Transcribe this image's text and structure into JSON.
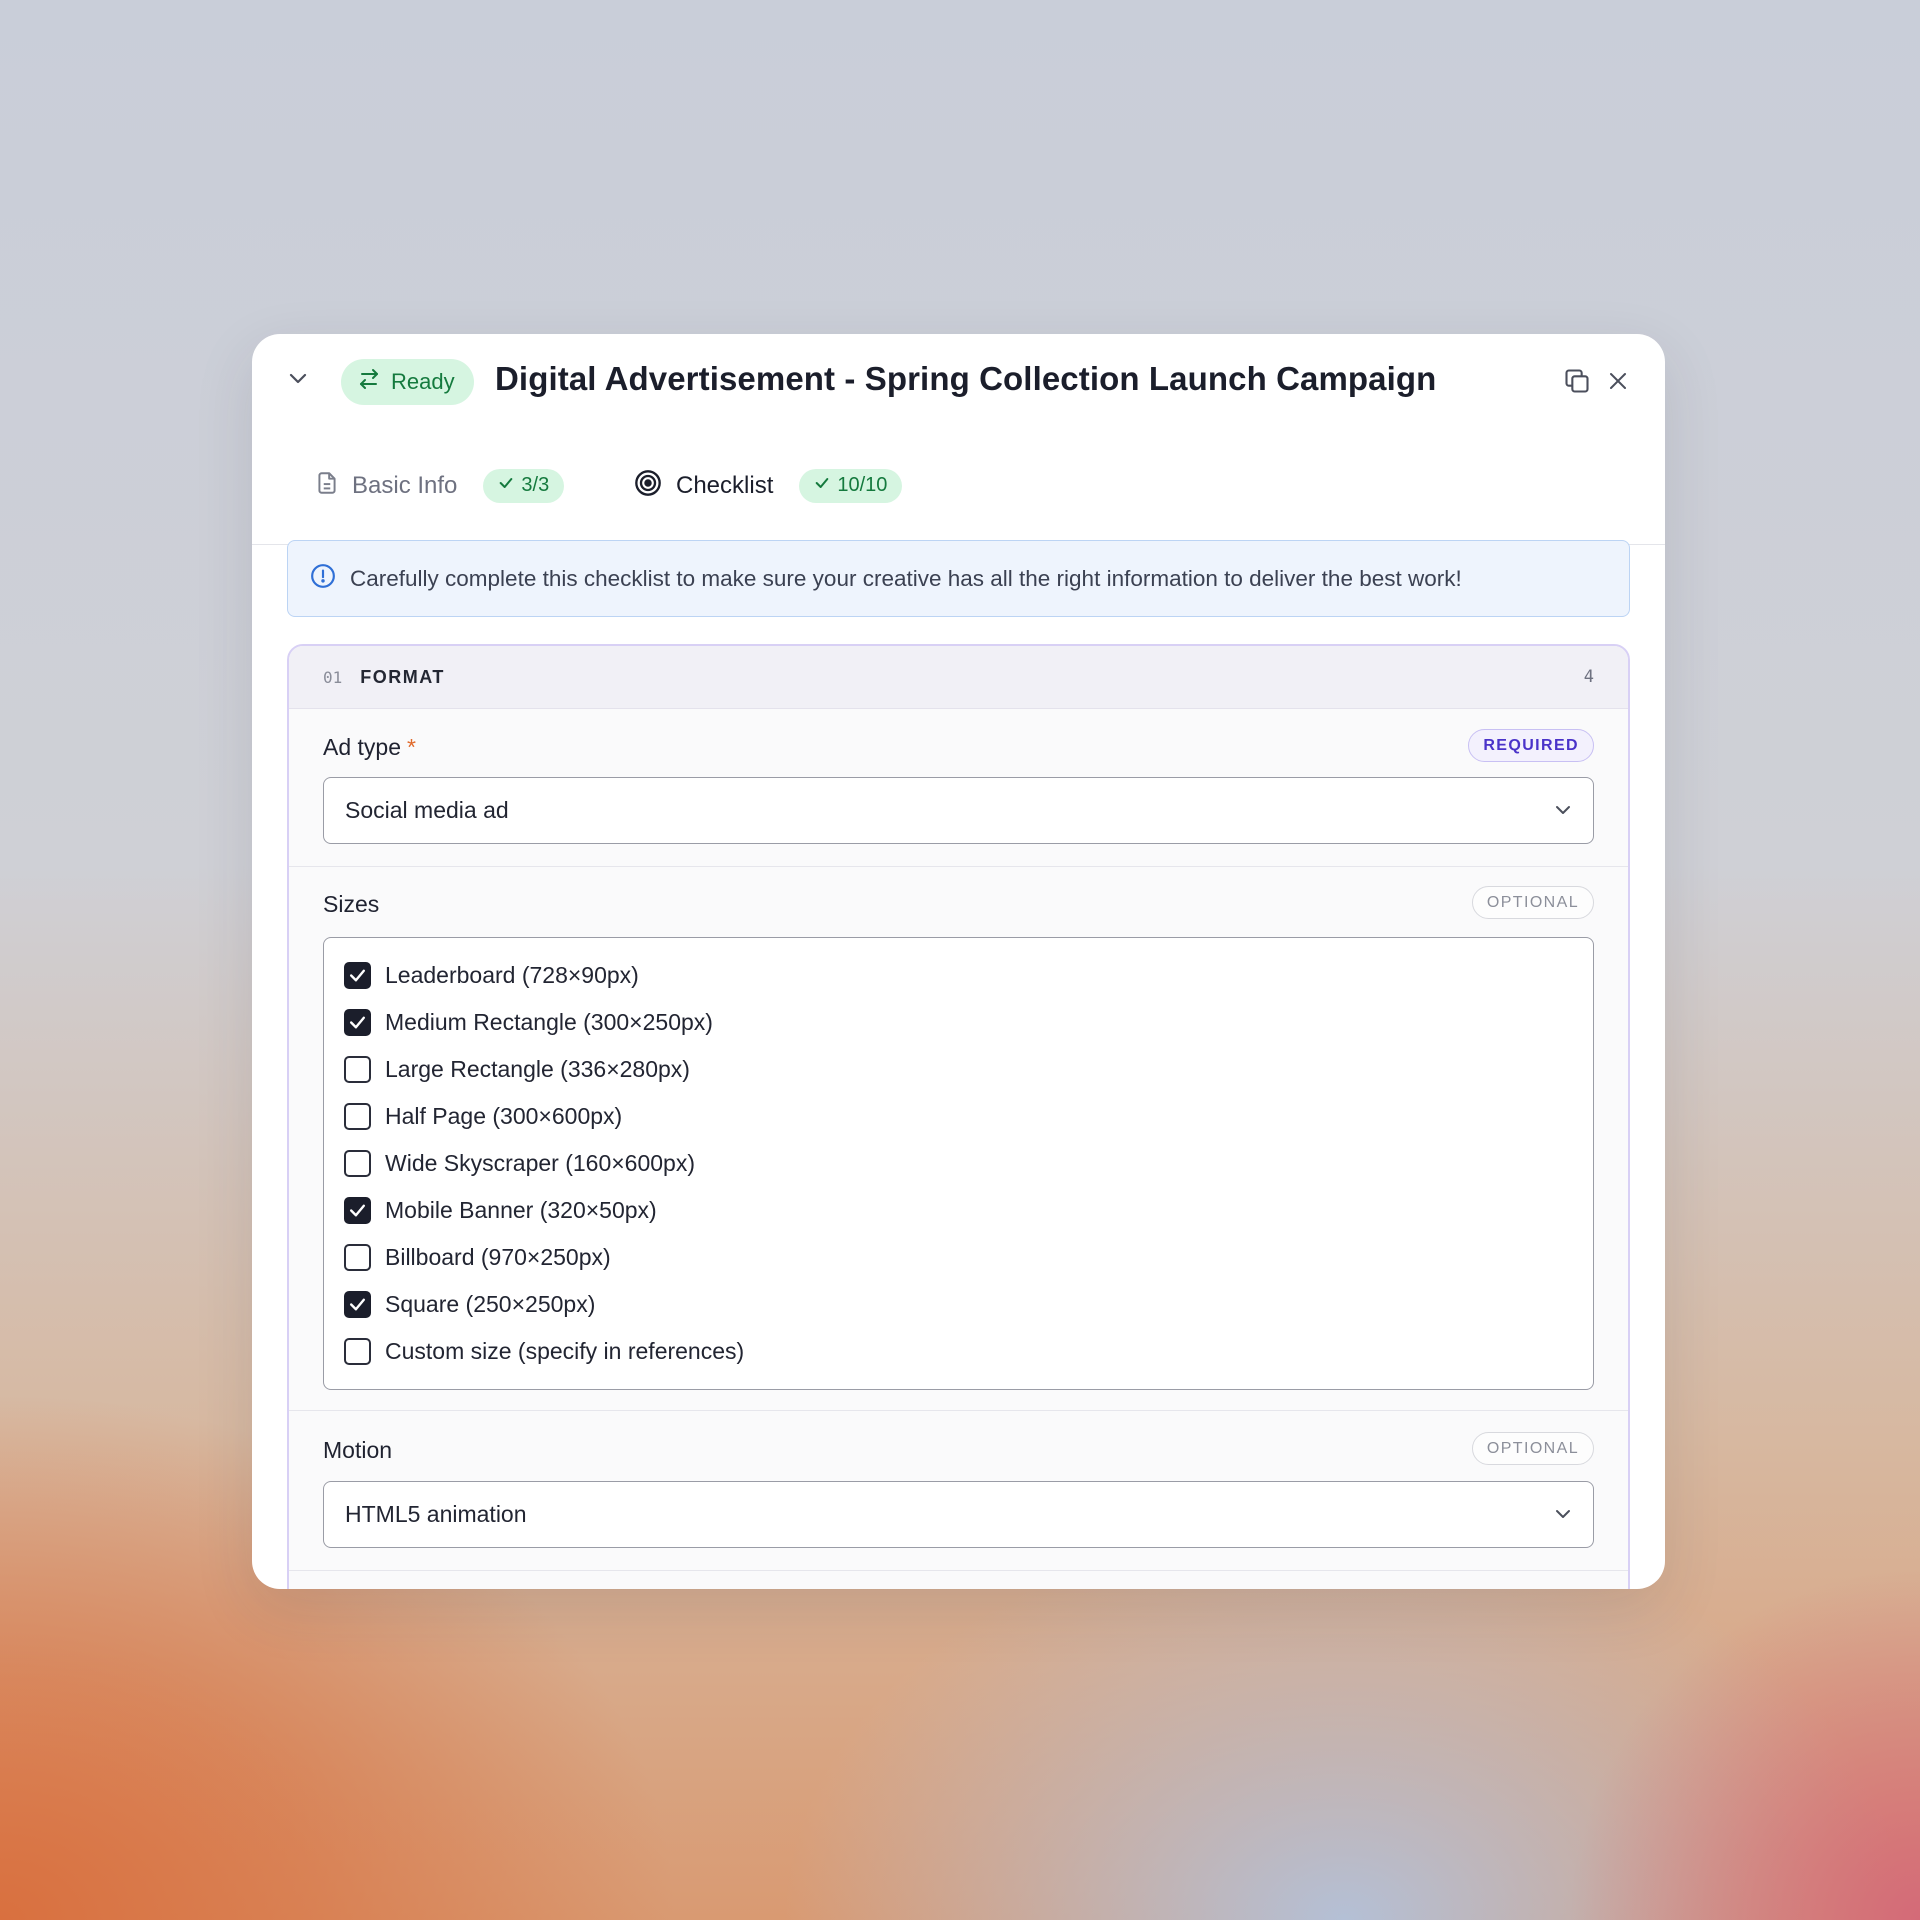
{
  "header": {
    "status": "Ready",
    "title": "Digital Advertisement - Spring Collection Launch Campaign"
  },
  "tabs": [
    {
      "label": "Basic Info",
      "badge": "3/3",
      "active": false
    },
    {
      "label": "Checklist",
      "badge": "10/10",
      "active": true
    }
  ],
  "banner": {
    "text": "Carefully complete this checklist to make sure your creative has all the right information to deliver the best work!"
  },
  "section": {
    "number": "01",
    "name": "FORMAT",
    "count": "4",
    "fields": {
      "ad_type": {
        "label": "Ad type",
        "required_mark": "*",
        "tag": "REQUIRED",
        "value": "Social media ad"
      },
      "sizes": {
        "label": "Sizes",
        "tag": "OPTIONAL",
        "options": [
          {
            "label": "Leaderboard (728×90px)",
            "checked": true
          },
          {
            "label": "Medium Rectangle (300×250px)",
            "checked": true
          },
          {
            "label": "Large Rectangle (336×280px)",
            "checked": false
          },
          {
            "label": "Half Page (300×600px)",
            "checked": false
          },
          {
            "label": "Wide Skyscraper (160×600px)",
            "checked": false
          },
          {
            "label": "Mobile Banner (320×50px)",
            "checked": true
          },
          {
            "label": "Billboard (970×250px)",
            "checked": false
          },
          {
            "label": "Square (250×250px)",
            "checked": true
          },
          {
            "label": "Custom size (specify in references)",
            "checked": false
          }
        ]
      },
      "motion": {
        "label": "Motion",
        "tag": "OPTIONAL",
        "value": "HTML5 animation"
      }
    }
  },
  "colors": {
    "accent": "#8b78e6",
    "success_bg": "#d6f5e1",
    "success_text": "#157a3e",
    "info_bg": "#eef4fd"
  }
}
